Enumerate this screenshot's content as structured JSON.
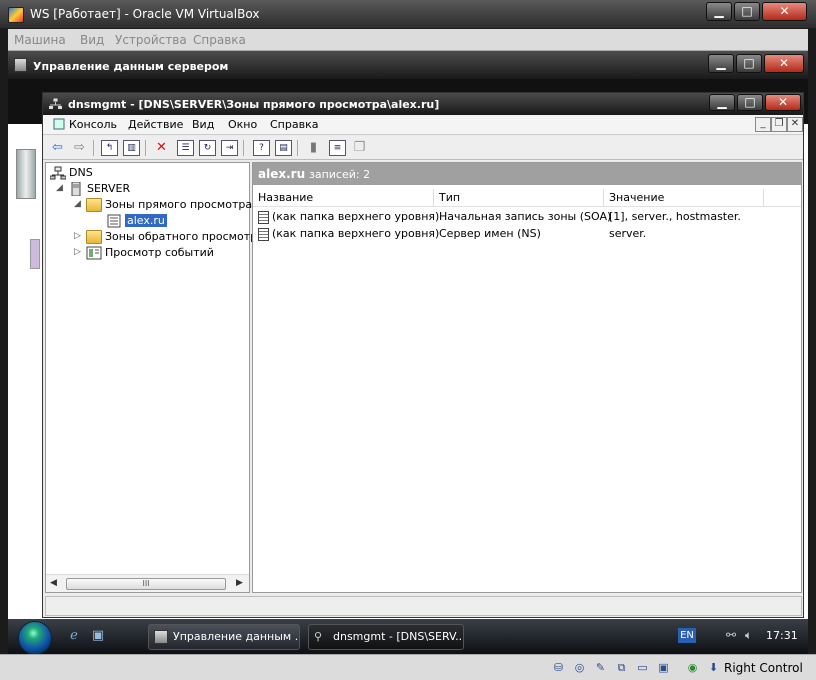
{
  "host": {
    "title": "WS [Работает] - Oracle VM VirtualBox",
    "menu": [
      "Машина",
      "Вид",
      "Устройства",
      "Справка"
    ],
    "caption_buttons": {
      "minimize": "▁",
      "maximize": "□",
      "close": "✕"
    }
  },
  "server_manager": {
    "title": "Управление данным сервером"
  },
  "dnsmgmt": {
    "title": "dnsmgmt - [DNS\\SERVER\\Зоны прямого просмотра\\alex.ru]",
    "menu": [
      "Консоль",
      "Действие",
      "Вид",
      "Окно",
      "Справка"
    ],
    "tree": {
      "root": "DNS",
      "server": "SERVER",
      "forward_zones": "Зоны прямого просмотра",
      "zone": "alex.ru",
      "reverse_zones": "Зоны обратного просмотра",
      "event_viewer": "Просмотр событий",
      "scroll_thumb": "III"
    },
    "details": {
      "zone_name": "alex.ru",
      "record_count": "записей: 2",
      "columns": [
        "Название",
        "Тип",
        "Значение"
      ],
      "rows": [
        {
          "name": "(как папка верхнего уровня)",
          "type": "Начальная запись зоны (SOA)",
          "value": "[1], server., hostmaster."
        },
        {
          "name": "(как папка верхнего уровня)",
          "type": "Сервер имен (NS)",
          "value": "server."
        }
      ]
    }
  },
  "taskbar": {
    "tasks": [
      "Управление данным ...",
      "dnsmgmt - [DNS\\SERV..."
    ],
    "language": "EN",
    "clock": "17:31"
  },
  "vb_status": {
    "host_key": "Right Control"
  },
  "colors": {
    "selection": "#3169c6",
    "title_bar": "#1a1a1a",
    "details_header": "#a0a0a0"
  }
}
